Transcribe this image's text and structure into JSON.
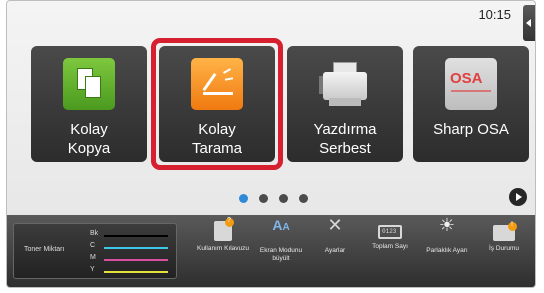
{
  "status": {
    "time": "10:15"
  },
  "tiles": [
    {
      "label_line1": "Kolay",
      "label_line2": "Kopya",
      "icon": "copy-icon",
      "color": "#5aae2a"
    },
    {
      "label_line1": "Kolay",
      "label_line2": "Tarama",
      "icon": "scan-icon",
      "color": "#f59a23"
    },
    {
      "label_line1": "Yazdırma",
      "label_line2": "Serbest",
      "icon": "printer-icon",
      "color": "#cfcfcf"
    },
    {
      "label_line1": "Sharp OSA",
      "label_line2": "",
      "icon": "osa-icon",
      "color": "#e04040"
    }
  ],
  "selection_color": "#d6202f",
  "pager": {
    "pages": 4,
    "active": 0,
    "active_color": "#2e89d6"
  },
  "toner": {
    "title": "Toner Miktarı",
    "rows": [
      {
        "key": "Bk",
        "color": "#000000"
      },
      {
        "key": "C",
        "color": "#3cc7e8"
      },
      {
        "key": "M",
        "color": "#d84fa0"
      },
      {
        "key": "Y",
        "color": "#e6e03a"
      }
    ]
  },
  "bottom_items": [
    {
      "label": "Kullanım Kılavuzu",
      "icon": "manual-icon"
    },
    {
      "label": "Ekran Modunu büyült",
      "icon": "enlarge-text-icon"
    },
    {
      "label": "Ayarlar",
      "icon": "settings-tools-icon"
    },
    {
      "label": "Toplam Sayı",
      "icon": "counter-icon"
    },
    {
      "label": "Parlaklık Ayarı",
      "icon": "brightness-icon"
    },
    {
      "label": "İş Durumu",
      "icon": "job-status-icon"
    }
  ]
}
